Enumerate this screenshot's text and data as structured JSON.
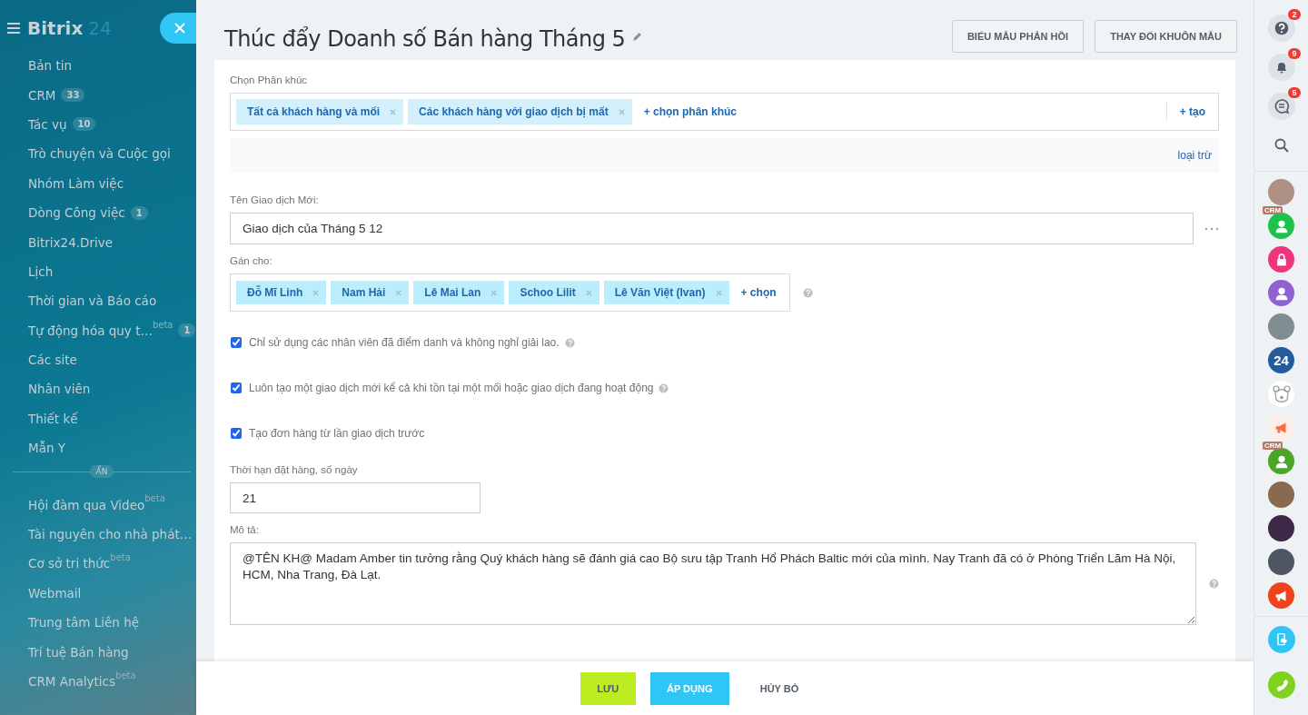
{
  "sidebar": {
    "logo": "Bitrix",
    "logo_suffix": "24",
    "items": [
      {
        "label": "Bản tin"
      },
      {
        "label": "CRM",
        "counter": "33"
      },
      {
        "label": "Tác vụ",
        "counter": "10"
      },
      {
        "label": "Trò chuyện và Cuộc gọi"
      },
      {
        "label": "Nhóm Làm việc"
      },
      {
        "label": "Dòng Công việc",
        "counter": "1"
      },
      {
        "label": "Bitrix24.Drive"
      },
      {
        "label": "Lịch"
      },
      {
        "label": "Thời gian và Báo cáo"
      },
      {
        "label": "Tự động hóa quy t…",
        "beta": "beta",
        "counter": "1"
      },
      {
        "label": "Các site"
      },
      {
        "label": "Nhân viên"
      },
      {
        "label": "Thiết kế"
      },
      {
        "label": "Mẫn Y"
      }
    ],
    "hidden_label": "ẨN",
    "hidden_items": [
      {
        "label": "Hội đàm qua Video",
        "beta": "beta"
      },
      {
        "label": "Tài nguyên cho nhà phát…"
      },
      {
        "label": "Cơ sở tri thức",
        "beta": "beta"
      },
      {
        "label": "Webmail"
      },
      {
        "label": "Trung tâm Liên hệ"
      },
      {
        "label": "Trí tuệ Bán hàng"
      },
      {
        "label": "CRM Analytics",
        "beta": "beta"
      }
    ]
  },
  "header": {
    "title": "Thúc đẩy Doanh số Bán hàng Tháng 5",
    "buttons": [
      "BIỂU MẪU PHẢN HỒI",
      "THAY ĐỔI KHUÔN MẪU"
    ]
  },
  "form": {
    "segments": {
      "label": "Chọn Phân khúc",
      "tags": [
        "Tất cả khách hàng và mối",
        "Các khách hàng với giao dịch bị mất"
      ],
      "add": "+ chọn phân khúc",
      "create": "+ tạo",
      "exclude": "loại trừ"
    },
    "deal_name": {
      "label": "Tên Giao dịch Mới:",
      "value": "Giao dịch của Tháng 5 12"
    },
    "assign": {
      "label": "Gán cho:",
      "tags": [
        "Đỗ Mĩ Linh",
        "Nam Hải",
        "Lê Mai Lan",
        "Schoo Lilit",
        "Lê Văn Việt (Ivan)"
      ],
      "add": "+ chọn"
    },
    "options": [
      {
        "label": "Chỉ sử dụng các nhân viên đã điểm danh và không nghỉ giải lao.",
        "checked": true,
        "help": true
      },
      {
        "label": "Luôn tạo một giao dịch mới kể cả khi tồn tại một mối hoặc giao dịch đang hoạt động",
        "checked": true,
        "help": true
      },
      {
        "label": "Tạo đơn hàng từ lần giao dịch trước",
        "checked": true,
        "help": false
      }
    ],
    "days": {
      "label": "Thời hạn đặt hàng, số ngày",
      "value": "21"
    },
    "description": {
      "label": "Mô tả:",
      "value": "@TÊN KH@ Madam Amber tin tưởng rằng Quý khách hàng sẽ đánh giá cao Bộ sưu tập Tranh Hổ Phách Baltic mới của mình. Nay Tranh đã có ở Phòng Triển Lãm Hà Nội, HCM, Nha Trang, Đà Lạt."
    }
  },
  "footer": {
    "buttons": [
      {
        "label": "LƯU",
        "kind": "save"
      },
      {
        "label": "ÁP DỤNG",
        "kind": "apply"
      },
      {
        "label": "HỦY BỎ",
        "kind": "cancel"
      }
    ]
  },
  "right_bar": {
    "tools": [
      {
        "kind": "help",
        "badge": "2"
      },
      {
        "kind": "bell",
        "badge": "9"
      },
      {
        "kind": "chat",
        "badge": "5"
      },
      {
        "kind": "search"
      }
    ],
    "contacts": [
      {
        "kind": "photo",
        "color": "#b08f84"
      },
      {
        "kind": "person",
        "color": "#1ec14b",
        "tag": "CRM"
      },
      {
        "kind": "lock",
        "color": "#f0357f"
      },
      {
        "kind": "person",
        "color": "#8e63d0"
      },
      {
        "kind": "photo",
        "color": "#7f8c90"
      },
      {
        "kind": "text",
        "color": "#235b9c",
        "text": "24"
      },
      {
        "kind": "bear",
        "color": "#ffffff"
      },
      {
        "kind": "megaphone",
        "color": "#fbeee8"
      },
      {
        "kind": "person",
        "color": "#4aa625",
        "tag": "CRM"
      },
      {
        "kind": "photo",
        "color": "#8a6a4f"
      },
      {
        "kind": "photo",
        "color": "#3e2848"
      },
      {
        "kind": "photo",
        "color": "#4d5662"
      },
      {
        "kind": "megaphone",
        "color": "#f0431d"
      }
    ],
    "bottom": [
      {
        "kind": "phone-cloud",
        "color": "#2fc6f6"
      },
      {
        "kind": "phone",
        "color": "#7fd320"
      }
    ]
  }
}
